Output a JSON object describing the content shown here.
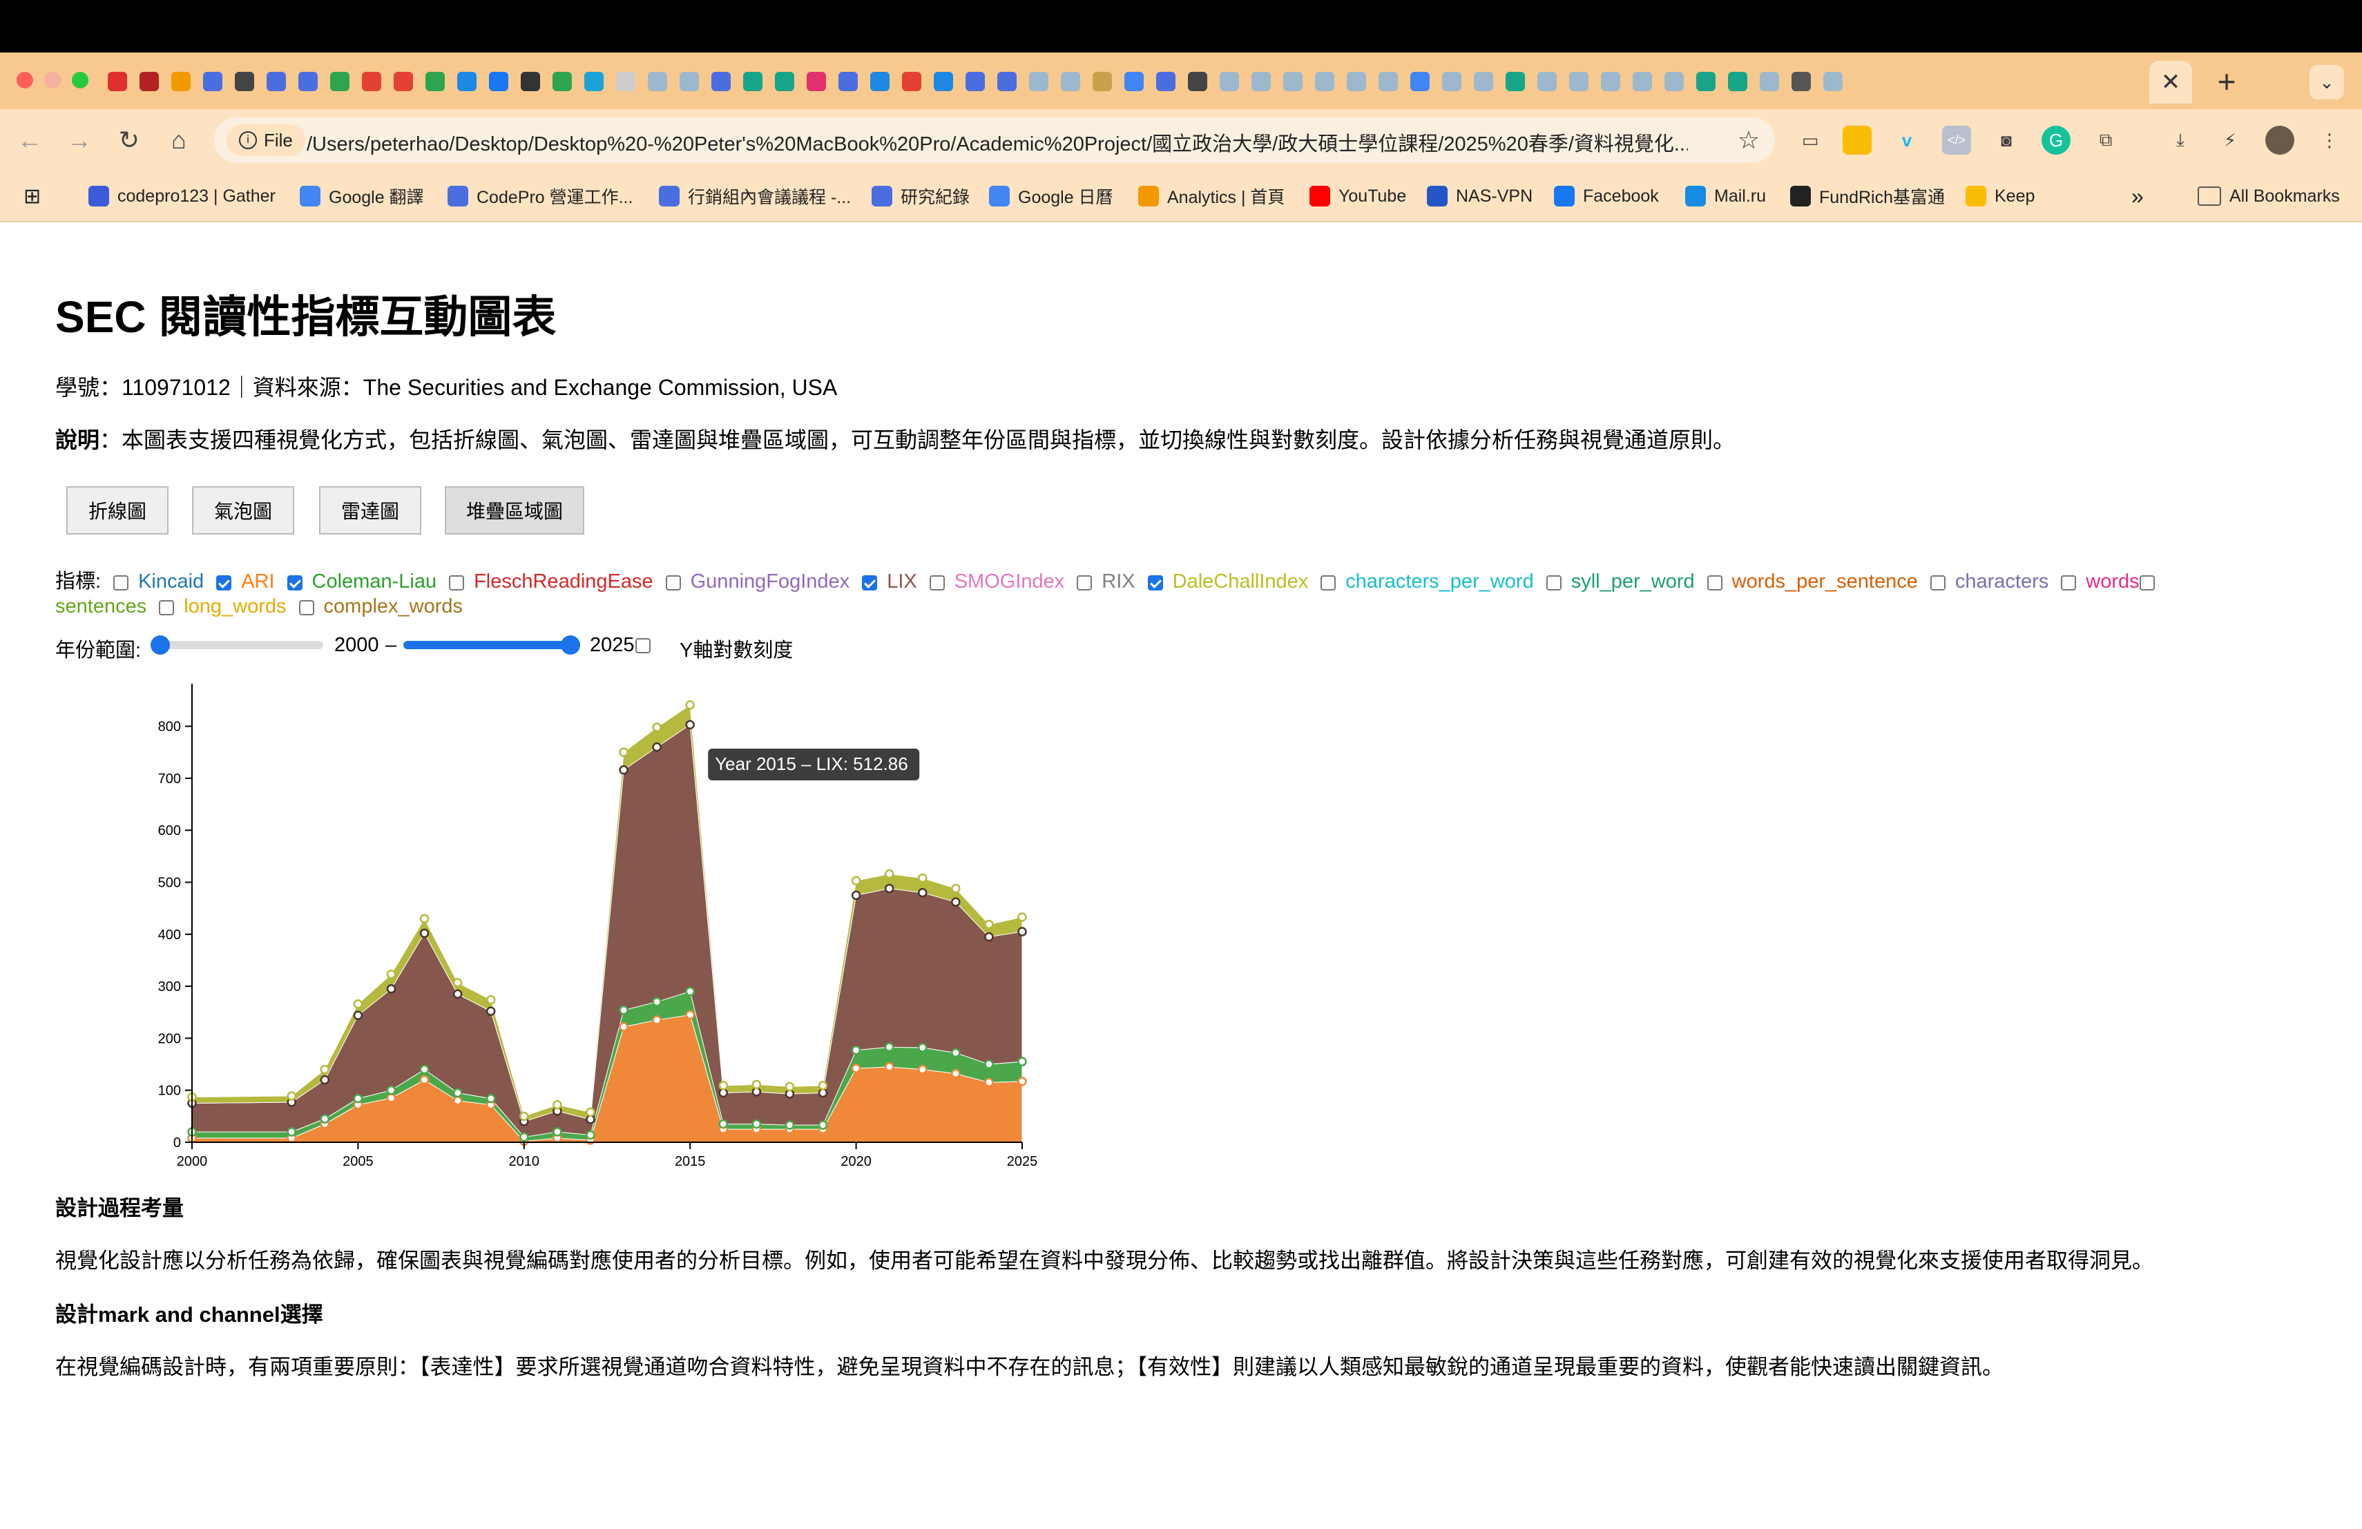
{
  "browser": {
    "url": "/Users/peterhao/Desktop/Desktop%20-%20Peter's%20MacBook%20Pro/Academic%20Project/國立政治大學/政大碩士學位課程/2025%20春季/資料視覺化...",
    "file_chip": "File",
    "tab_close": "✕",
    "new_tab": "+",
    "bookmarks": [
      {
        "label": "codepro123 | Gather",
        "color": "#3b5bdb"
      },
      {
        "label": "Google 翻譯",
        "color": "#4285f4"
      },
      {
        "label": "CodePro 營運工作...",
        "color": "#4a6ee0"
      },
      {
        "label": "行銷組內會議議程 -...",
        "color": "#4a6ee0"
      },
      {
        "label": "研究紀錄",
        "color": "#4a6ee0"
      },
      {
        "label": "Google 日曆",
        "color": "#4285f4"
      },
      {
        "label": "Analytics | 首頁",
        "color": "#f29900"
      },
      {
        "label": "YouTube",
        "color": "#ff0000"
      },
      {
        "label": "NAS-VPN",
        "color": "#2457c5"
      },
      {
        "label": "Facebook",
        "color": "#1877f2"
      },
      {
        "label": "Mail.ru",
        "color": "#168de2"
      },
      {
        "label": "FundRich基富通",
        "color": "#222222"
      },
      {
        "label": "Keep",
        "color": "#fbbc04"
      }
    ],
    "bookmarks_more": "»",
    "all_bookmarks": "All Bookmarks"
  },
  "page": {
    "title": "SEC 閱讀性指標互動圖表",
    "subtitle": "學號：110971012｜資料來源：The Securities and Exchange Commission, USA",
    "desc_label": "說明",
    "desc_text": "：本圖表支援四種視覺化方式，包括折線圖、氣泡圖、雷達圖與堆疊區域圖，可互動調整年份區間與指標，並切換線性與對數刻度。設計依據分析任務與視覺通道原則。",
    "view_buttons": [
      "折線圖",
      "氣泡圖",
      "雷達圖",
      "堆疊區域圖"
    ],
    "active_view": "堆疊區域圖",
    "metrics_label": "指標:",
    "metrics": [
      {
        "name": "Kincaid",
        "checked": false,
        "color": "#1f77b4"
      },
      {
        "name": "ARI",
        "checked": true,
        "color": "#ff7f0e"
      },
      {
        "name": "Coleman-Liau",
        "checked": true,
        "color": "#2ca02c"
      },
      {
        "name": "FleschReadingEase",
        "checked": false,
        "color": "#d62728"
      },
      {
        "name": "GunningFogIndex",
        "checked": false,
        "color": "#9467bd"
      },
      {
        "name": "LIX",
        "checked": true,
        "color": "#8c564b"
      },
      {
        "name": "SMOGIndex",
        "checked": false,
        "color": "#e377c2"
      },
      {
        "name": "RIX",
        "checked": false,
        "color": "#7f7f7f"
      },
      {
        "name": "DaleChallIndex",
        "checked": true,
        "color": "#bcbd22"
      },
      {
        "name": "characters_per_word",
        "checked": false,
        "color": "#17becf"
      },
      {
        "name": "syll_per_word",
        "checked": false,
        "color": "#1b9e77"
      },
      {
        "name": "words_per_sentence",
        "checked": false,
        "color": "#d95f02"
      },
      {
        "name": "characters",
        "checked": false,
        "color": "#7570b3"
      },
      {
        "name": "words",
        "checked": false,
        "color": "#e7298a"
      },
      {
        "name": "sentences",
        "checked": false,
        "color": "#66a61e"
      },
      {
        "name": "long_words",
        "checked": false,
        "color": "#e6ab02"
      },
      {
        "name": "complex_words",
        "checked": false,
        "color": "#a6761d"
      }
    ],
    "year_range_label": "年份範圍:",
    "year_min": "2000",
    "year_dash": "–",
    "year_max": "2025",
    "log_scale_label": "Y軸對數刻度",
    "log_scale_checked": false,
    "design_h1": "設計過程考量",
    "design_p1": "視覺化設計應以分析任務為依歸，確保圖表與視覺編碼對應使用者的分析目標。例如，使用者可能希望在資料中發現分佈、比較趨勢或找出離群值。將設計決策與這些任務對應，可創建有效的視覺化來支援使用者取得洞見。",
    "design_h2": "設計mark and channel選擇",
    "design_p2": "在視覺編碼設計時，有兩項重要原則：【表達性】要求所選視覺通道吻合資料特性，避免呈現資料中不存在的訊息；【有效性】則建議以人類感知最敏銳的通道呈現最重要的資料，使觀者能快速讀出關鍵資訊。"
  },
  "chart_data": {
    "type": "area",
    "stacked": true,
    "x": [
      2000,
      2003,
      2004,
      2005,
      2006,
      2007,
      2008,
      2009,
      2010,
      2011,
      2012,
      2013,
      2014,
      2015,
      2016,
      2017,
      2018,
      2019,
      2020,
      2021,
      2022,
      2023,
      2024,
      2025
    ],
    "series": [
      {
        "name": "ARI",
        "color": "#f0883a",
        "values": [
          8,
          8,
          35,
          72,
          85,
          120,
          80,
          72,
          2,
          8,
          4,
          222,
          235,
          245,
          25,
          25,
          25,
          25,
          142,
          145,
          140,
          132,
          115,
          117
        ]
      },
      {
        "name": "Coleman-Liau",
        "color": "#4aa84a",
        "values": [
          12,
          12,
          10,
          12,
          15,
          20,
          15,
          12,
          8,
          12,
          10,
          32,
          35,
          45,
          10,
          10,
          8,
          8,
          35,
          38,
          42,
          40,
          35,
          38
        ]
      },
      {
        "name": "LIX",
        "color": "#86574d",
        "values": [
          55,
          57,
          75,
          160,
          195,
          262,
          190,
          168,
          30,
          40,
          30,
          462,
          490,
          513,
          60,
          62,
          60,
          62,
          298,
          305,
          298,
          290,
          245,
          250
        ]
      },
      {
        "name": "DaleChallIndex",
        "color": "#b5b93e",
        "values": [
          12,
          12,
          20,
          22,
          28,
          28,
          22,
          22,
          10,
          12,
          14,
          34,
          38,
          38,
          14,
          14,
          14,
          14,
          28,
          28,
          28,
          26,
          24,
          28
        ]
      }
    ],
    "xlim": [
      2000,
      2025
    ],
    "ylim": [
      0,
      850
    ],
    "xticks": [
      2000,
      2005,
      2010,
      2015,
      2020,
      2025
    ],
    "yticks": [
      0,
      100,
      200,
      300,
      400,
      500,
      600,
      700,
      800
    ],
    "tooltip": "Year 2015 – LIX: 512.86",
    "tooltip_x": 2015,
    "grid": false
  }
}
